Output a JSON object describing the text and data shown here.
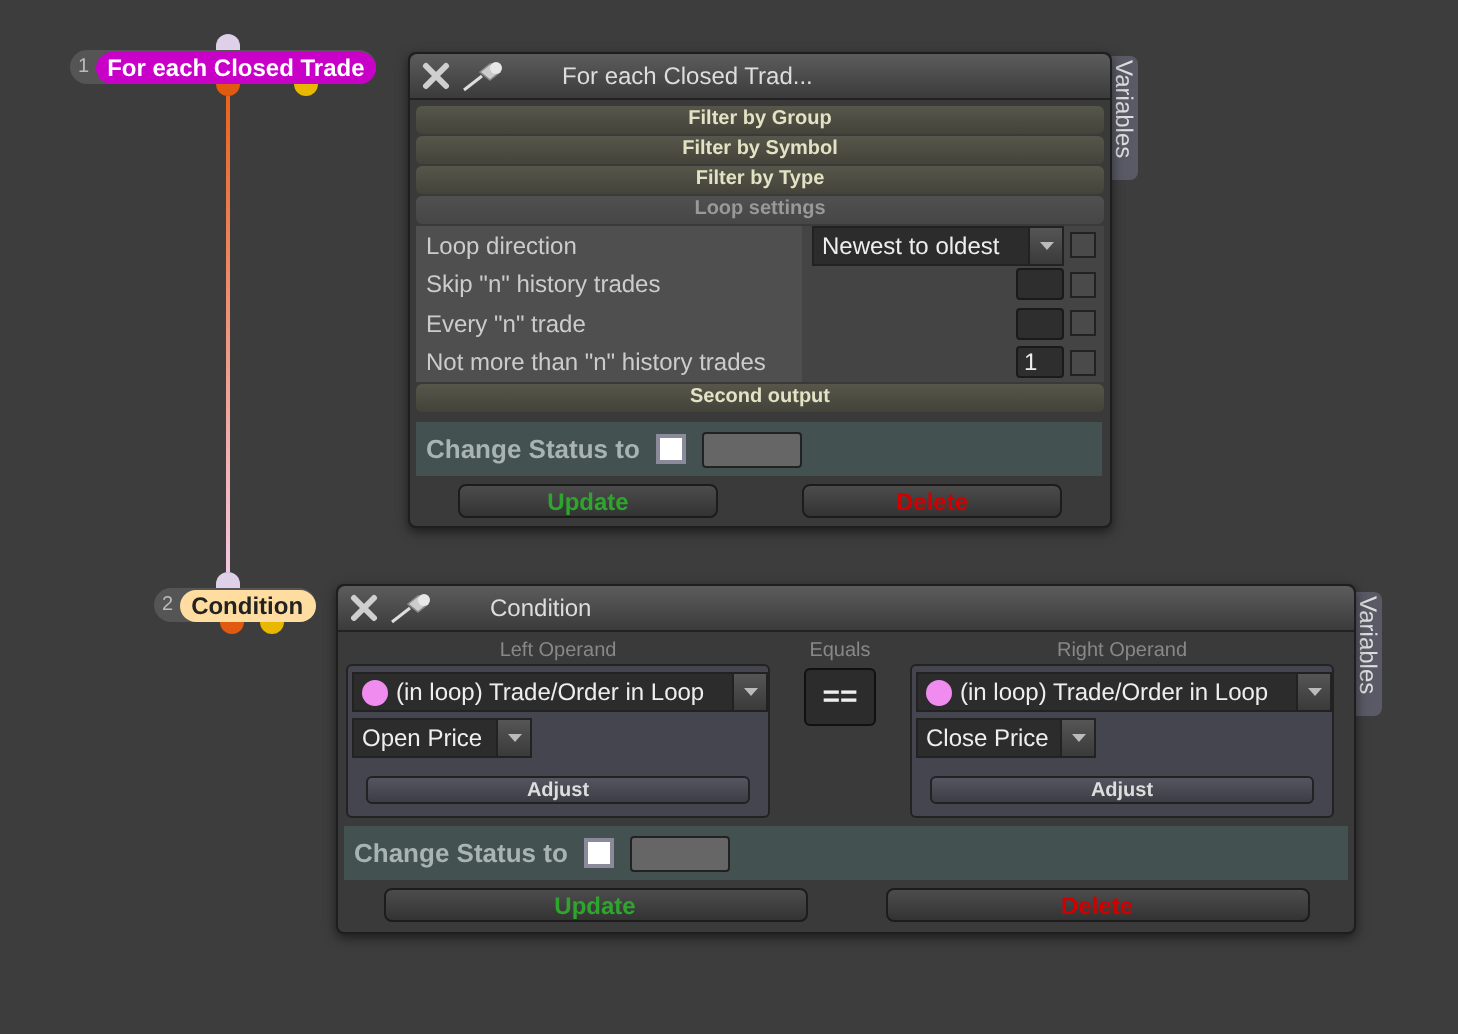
{
  "nodes": [
    {
      "number": "1",
      "title": "For each Closed Trade",
      "color": "#c800c8"
    },
    {
      "number": "2",
      "title": "Condition",
      "color": "#ffdca0"
    }
  ],
  "loop_window": {
    "title": "For each Closed Trad...",
    "side_tab": "Variables",
    "sections": [
      {
        "label": "Filter by Group",
        "expanded": false
      },
      {
        "label": "Filter by Symbol",
        "expanded": false
      },
      {
        "label": "Filter by Type",
        "expanded": false
      },
      {
        "label": "Loop settings",
        "expanded": true
      }
    ],
    "settings": [
      {
        "kind": "dropdown",
        "label": "Loop direction",
        "value": "Newest to oldest",
        "checked": false
      },
      {
        "kind": "number",
        "label": "Skip \"n\" history trades",
        "checked": false
      },
      {
        "kind": "number",
        "label": "Every \"n\" trade",
        "checked": false
      },
      {
        "kind": "number",
        "label": "Not more than \"n\" history trades",
        "value": "1",
        "checked": false
      }
    ],
    "second_section": {
      "label": "Second output",
      "expanded": false
    },
    "change_status": {
      "label": "Change Status to",
      "checked": false
    },
    "buttons": [
      {
        "kind": "update",
        "label": "Update"
      },
      {
        "kind": "delete",
        "label": "Delete"
      }
    ]
  },
  "condition_window": {
    "title": "Condition",
    "side_tab": "Variables",
    "operands": [
      {
        "heading": "Left Operand",
        "source": "(in loop) Trade/Order in Loop",
        "field": "Open Price",
        "button": "Adjust"
      },
      {
        "heading": "Right Operand",
        "source": "(in loop) Trade/Order in Loop",
        "field": "Close Price",
        "button": "Adjust"
      }
    ],
    "operator_label": "Equals",
    "operator": "==",
    "change_status": {
      "label": "Change Status to",
      "checked": false
    },
    "buttons": [
      {
        "kind": "update",
        "label": "Update"
      },
      {
        "kind": "delete",
        "label": "Delete"
      }
    ]
  }
}
